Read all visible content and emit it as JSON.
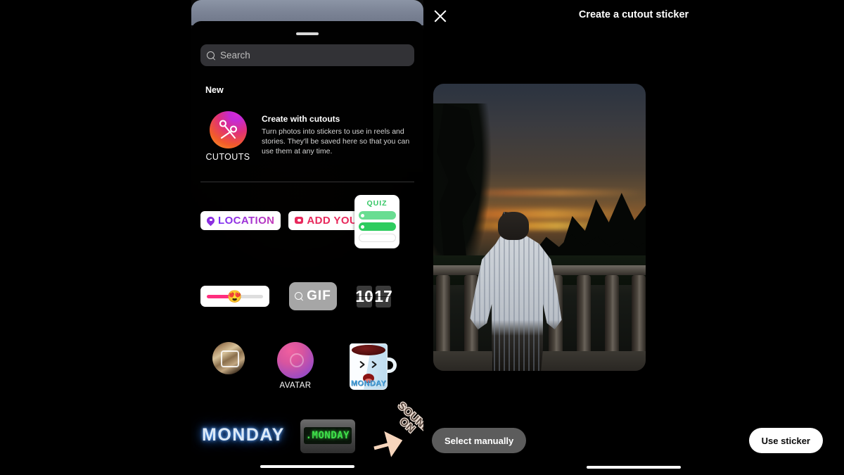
{
  "sticker_tray": {
    "search": {
      "placeholder": "Search",
      "icon": "search-icon"
    },
    "section_label": "New",
    "promo": {
      "icon_name": "cutouts-scissors-icon",
      "icon_caption": "CUTOUTS",
      "title": "Create with cutouts",
      "body": "Turn photos into stickers to use in reels and stories. They'll be saved here so that you can use them at any time."
    },
    "stickers": [
      {
        "name": "location-sticker",
        "label": "LOCATION",
        "icon": "map-pin-icon",
        "color": "#8b2fe0"
      },
      {
        "name": "add-yours-sticker",
        "label": "ADD YOURS",
        "icon": "camera-icon",
        "color": "#e8295c"
      },
      {
        "name": "quiz-sticker",
        "label": "QUIZ",
        "color": "#35c765"
      },
      {
        "name": "slider-sticker",
        "label": "",
        "emoji": "😍"
      },
      {
        "name": "gif-sticker",
        "label": "GIF",
        "icon": "search-icon"
      },
      {
        "name": "time-sticker",
        "hours": "10",
        "minutes": "17"
      },
      {
        "name": "photo-sticker",
        "label": ""
      },
      {
        "name": "avatar-sticker",
        "label": "AVATAR"
      },
      {
        "name": "monday-mug-sticker",
        "label": "MONDAY"
      },
      {
        "name": "monday-neon-sticker",
        "label": "MONDAY"
      },
      {
        "name": "monday-clock-radio-sticker",
        "label": ".MONDAY"
      },
      {
        "name": "sound-on-sticker",
        "line1": "SOUND",
        "line2": "ON"
      }
    ]
  },
  "cutout_editor": {
    "close_icon": "close-icon",
    "title": "Create a cutout sticker",
    "preview": {
      "name": "photo-preview",
      "description": "Person silhouette cutout highlighted over a park sunset photo"
    },
    "buttons": {
      "secondary": "Select manually",
      "primary": "Use sticker"
    }
  }
}
